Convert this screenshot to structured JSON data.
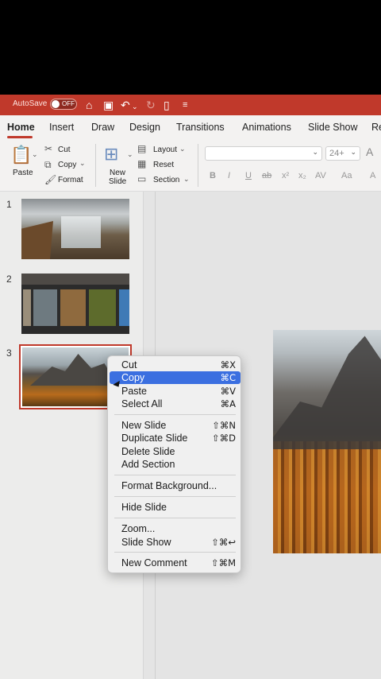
{
  "titlebar": {
    "autosave_label": "AutoSave",
    "autosave_state": "OFF"
  },
  "tabs": [
    "Home",
    "Insert",
    "Draw",
    "Design",
    "Transitions",
    "Animations",
    "Slide Show",
    "Re"
  ],
  "toolbar": {
    "paste": "Paste",
    "cut": "Cut",
    "copy": "Copy",
    "format": "Format",
    "new_slide_line1": "New",
    "new_slide_line2": "Slide",
    "layout": "Layout",
    "reset": "Reset",
    "section": "Section",
    "font_size": "24+"
  },
  "thumbnails": {
    "numbers": [
      "1",
      "2",
      "3"
    ]
  },
  "context_menu": {
    "items": [
      {
        "label": "Cut",
        "shortcut": "⌘X"
      },
      {
        "label": "Copy",
        "shortcut": "⌘C"
      },
      {
        "label": "Paste",
        "shortcut": "⌘V"
      },
      {
        "label": "Select All",
        "shortcut": "⌘A"
      },
      {
        "label": "New Slide",
        "shortcut": "⇧⌘N"
      },
      {
        "label": "Duplicate Slide",
        "shortcut": "⇧⌘D"
      },
      {
        "label": "Delete Slide",
        "shortcut": ""
      },
      {
        "label": "Add Section",
        "shortcut": ""
      },
      {
        "label": "Format Background...",
        "shortcut": ""
      },
      {
        "label": "Hide Slide",
        "shortcut": ""
      },
      {
        "label": "Zoom...",
        "shortcut": ""
      },
      {
        "label": "Slide Show",
        "shortcut": "⇧⌘↩"
      },
      {
        "label": "New Comment",
        "shortcut": "⇧⌘M"
      }
    ],
    "highlighted": "Copy"
  },
  "colors": {
    "accent": "#c0392b",
    "highlight": "#3b6fe0"
  }
}
